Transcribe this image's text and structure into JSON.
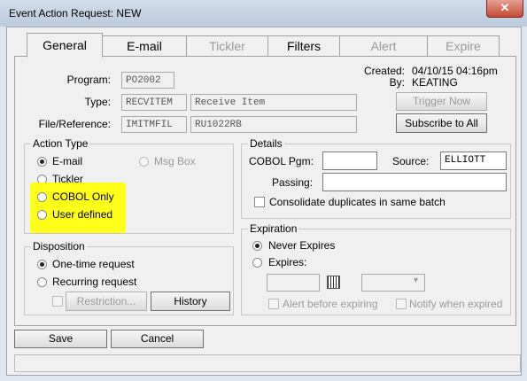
{
  "window": {
    "title": "Event Action Request: NEW",
    "close_glyph": "✕"
  },
  "tabs": [
    {
      "label": "General",
      "state": "active"
    },
    {
      "label": "E-mail",
      "state": "enabled"
    },
    {
      "label": "Tickler",
      "state": "disabled"
    },
    {
      "label": "Filters",
      "state": "enabled"
    },
    {
      "label": "Alert",
      "state": "disabled"
    },
    {
      "label": "Expire",
      "state": "disabled"
    }
  ],
  "header": {
    "program_label": "Program:",
    "program_value": "PO2002",
    "type_label": "Type:",
    "type_code": "RECVITEM",
    "type_desc": "Receive Item",
    "fileref_label": "File/Reference:",
    "fileref_code": "IMITMFIL",
    "fileref_value": "RU1022RB",
    "created_label": "Created:",
    "created_value": "04/10/15 04:16pm",
    "by_label": "By:",
    "by_value": "KEATING",
    "trigger_now": "Trigger Now",
    "subscribe_all": "Subscribe to All"
  },
  "action_type": {
    "title": "Action Type",
    "options": [
      {
        "label": "E-mail",
        "selected": true,
        "enabled": true
      },
      {
        "label": "Msg Box",
        "selected": false,
        "enabled": false
      },
      {
        "label": "Tickler",
        "selected": false,
        "enabled": true
      },
      {
        "label": "COBOL Only",
        "selected": false,
        "enabled": true
      },
      {
        "label": "User defined",
        "selected": false,
        "enabled": true
      }
    ],
    "highlight_color": "#ffff19"
  },
  "details": {
    "title": "Details",
    "cobol_pgm_label": "COBOL Pgm:",
    "cobol_pgm_value": "",
    "source_label": "Source:",
    "source_value": "ELLIOTT",
    "passing_label": "Passing:",
    "passing_value": "",
    "consolidate_label": "Consolidate duplicates in same batch",
    "consolidate_checked": false
  },
  "disposition": {
    "title": "Disposition",
    "options": [
      {
        "label": "One-time request",
        "selected": true
      },
      {
        "label": "Recurring request",
        "selected": false
      }
    ],
    "restriction_button": "Restriction...",
    "history_button": "History"
  },
  "expiration": {
    "title": "Expiration",
    "options": [
      {
        "label": "Never Expires",
        "selected": true
      },
      {
        "label": "Expires:",
        "selected": false
      }
    ],
    "date_value": "",
    "time_value": "",
    "alert_label": "Alert before expiring",
    "notify_label": "Notify when expired"
  },
  "footer": {
    "save": "Save",
    "cancel": "Cancel",
    "status": ""
  }
}
